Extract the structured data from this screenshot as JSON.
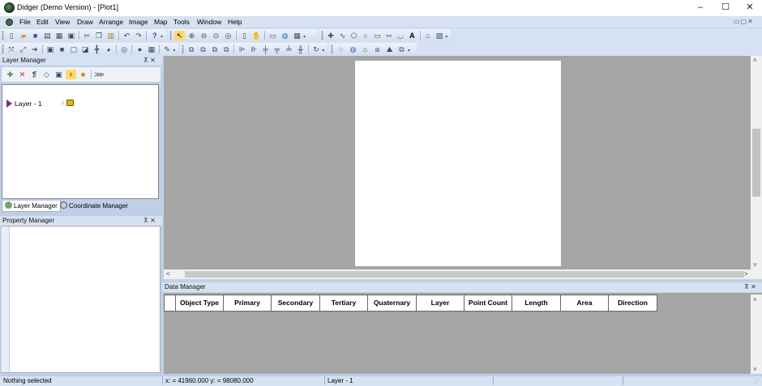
{
  "window": {
    "title": "Didger (Demo Version) - [Plot1]",
    "minimize": "–",
    "maximize": "☐",
    "close": "✕",
    "mdi_controls": "▭▢✕"
  },
  "menu": [
    "File",
    "Edit",
    "View",
    "Draw",
    "Arrange",
    "Image",
    "Map",
    "Tools",
    "Window",
    "Help"
  ],
  "layer_manager": {
    "title": "Layer Manager",
    "pin": "⊼ ✕",
    "layers": [
      {
        "name": "Layer - 1"
      }
    ],
    "tab_label": "Layer Manager"
  },
  "coordinate_manager": {
    "tab_label": "Coordinate Manager"
  },
  "property_manager": {
    "title": "Property Manager",
    "pin": "⊼ ✕"
  },
  "data_manager": {
    "title": "Data Manager",
    "pin": "⊼ ✕",
    "columns": [
      "Object Type",
      "Primary",
      "Secondary",
      "Tertiary",
      "Quaternary",
      "Layer",
      "Point Count",
      "Length",
      "Area",
      "Direction"
    ]
  },
  "status": {
    "message": "Nothing selected",
    "coords": "x: = 41960.000 y: = 98080.000",
    "layer": "Layer - 1"
  },
  "colors": {
    "accent": "#d6e2f2",
    "canvas": "#a5a5a5"
  }
}
